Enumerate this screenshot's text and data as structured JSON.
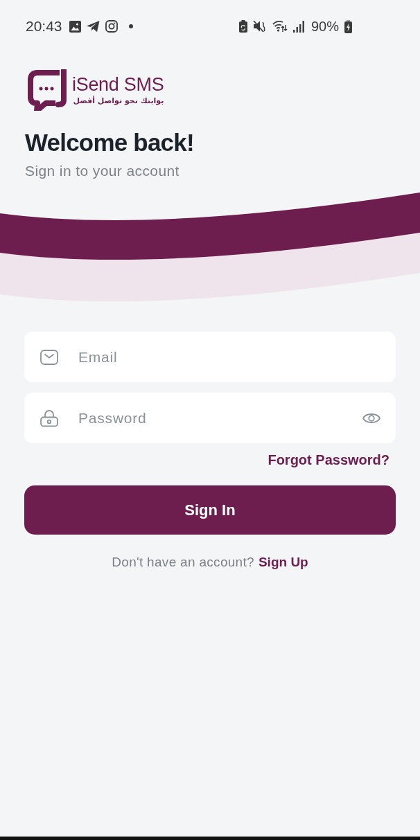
{
  "status_bar": {
    "time": "20:43",
    "battery": "90%"
  },
  "logo": {
    "name": "iSend SMS",
    "tagline": "بوابتك نحو تواصل أفضل"
  },
  "heading": {
    "title": "Welcome back!",
    "subtitle": "Sign in to your account"
  },
  "form": {
    "fields": [
      {
        "kind": "email",
        "placeholder": "Email"
      },
      {
        "kind": "password",
        "placeholder": "Password"
      }
    ],
    "forgot_link": "Forgot Password?",
    "submit": "Sign In"
  },
  "signup": {
    "prompt": "Don't have an account?",
    "link": "Sign Up"
  }
}
